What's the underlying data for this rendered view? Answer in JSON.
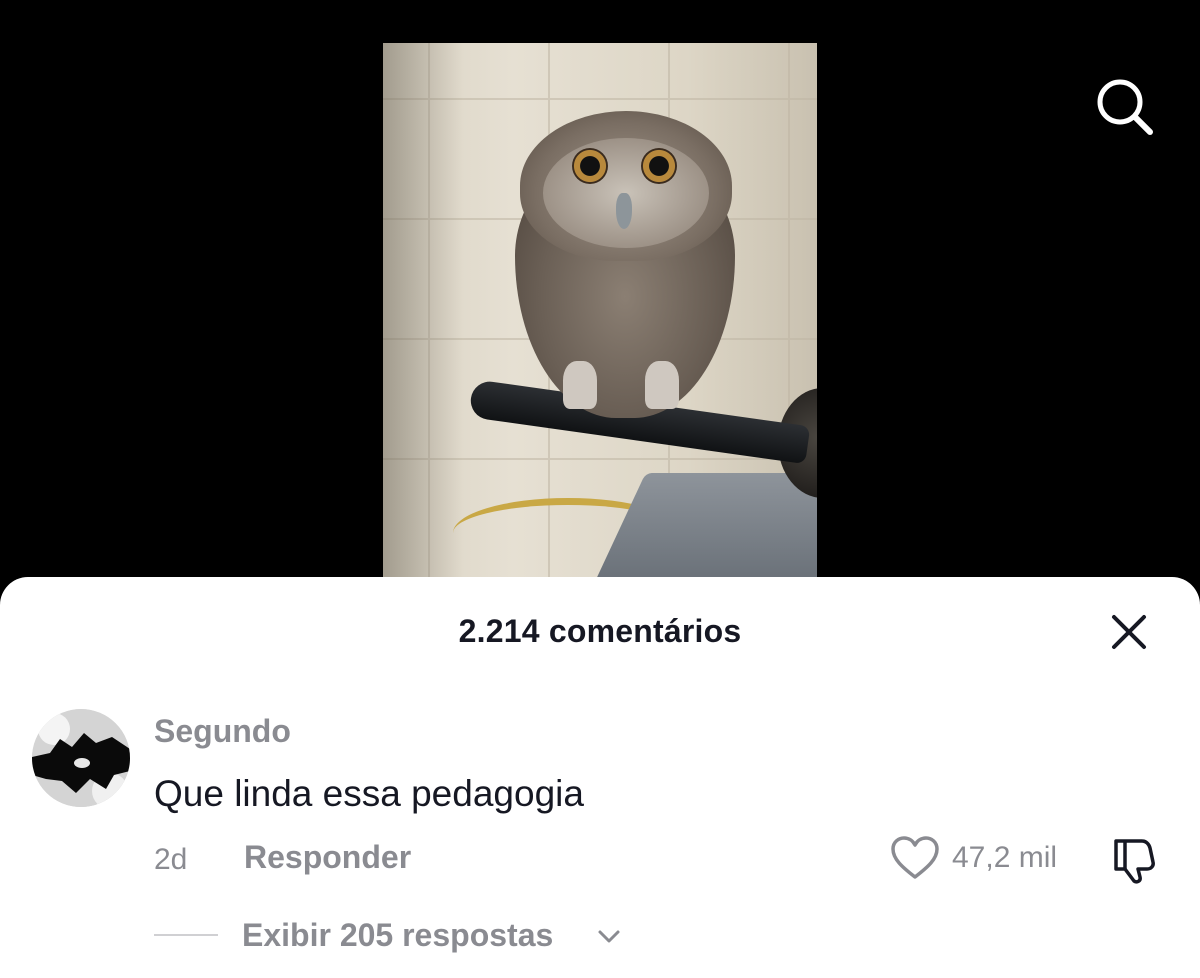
{
  "video": {
    "image_description": "owl perched on frying pan handle on a stove"
  },
  "header": {
    "search_icon": "search-icon"
  },
  "comments_sheet": {
    "title": "2.214 comentários",
    "close_icon": "close-icon",
    "comment": {
      "username": "Segundo",
      "text": "Que linda essa pedagogia",
      "time": "2d",
      "reply_label": "Responder",
      "like_count": "47,2 mil",
      "like_icon": "heart-icon",
      "dislike_icon": "thumbs-down-icon",
      "view_replies_label": "Exibir 205 respostas",
      "view_replies_icon": "chevron-down-icon"
    }
  },
  "colors": {
    "background": "#000000",
    "sheet": "#ffffff",
    "primary_text": "#161823",
    "secondary_text": "#8a8b91"
  }
}
